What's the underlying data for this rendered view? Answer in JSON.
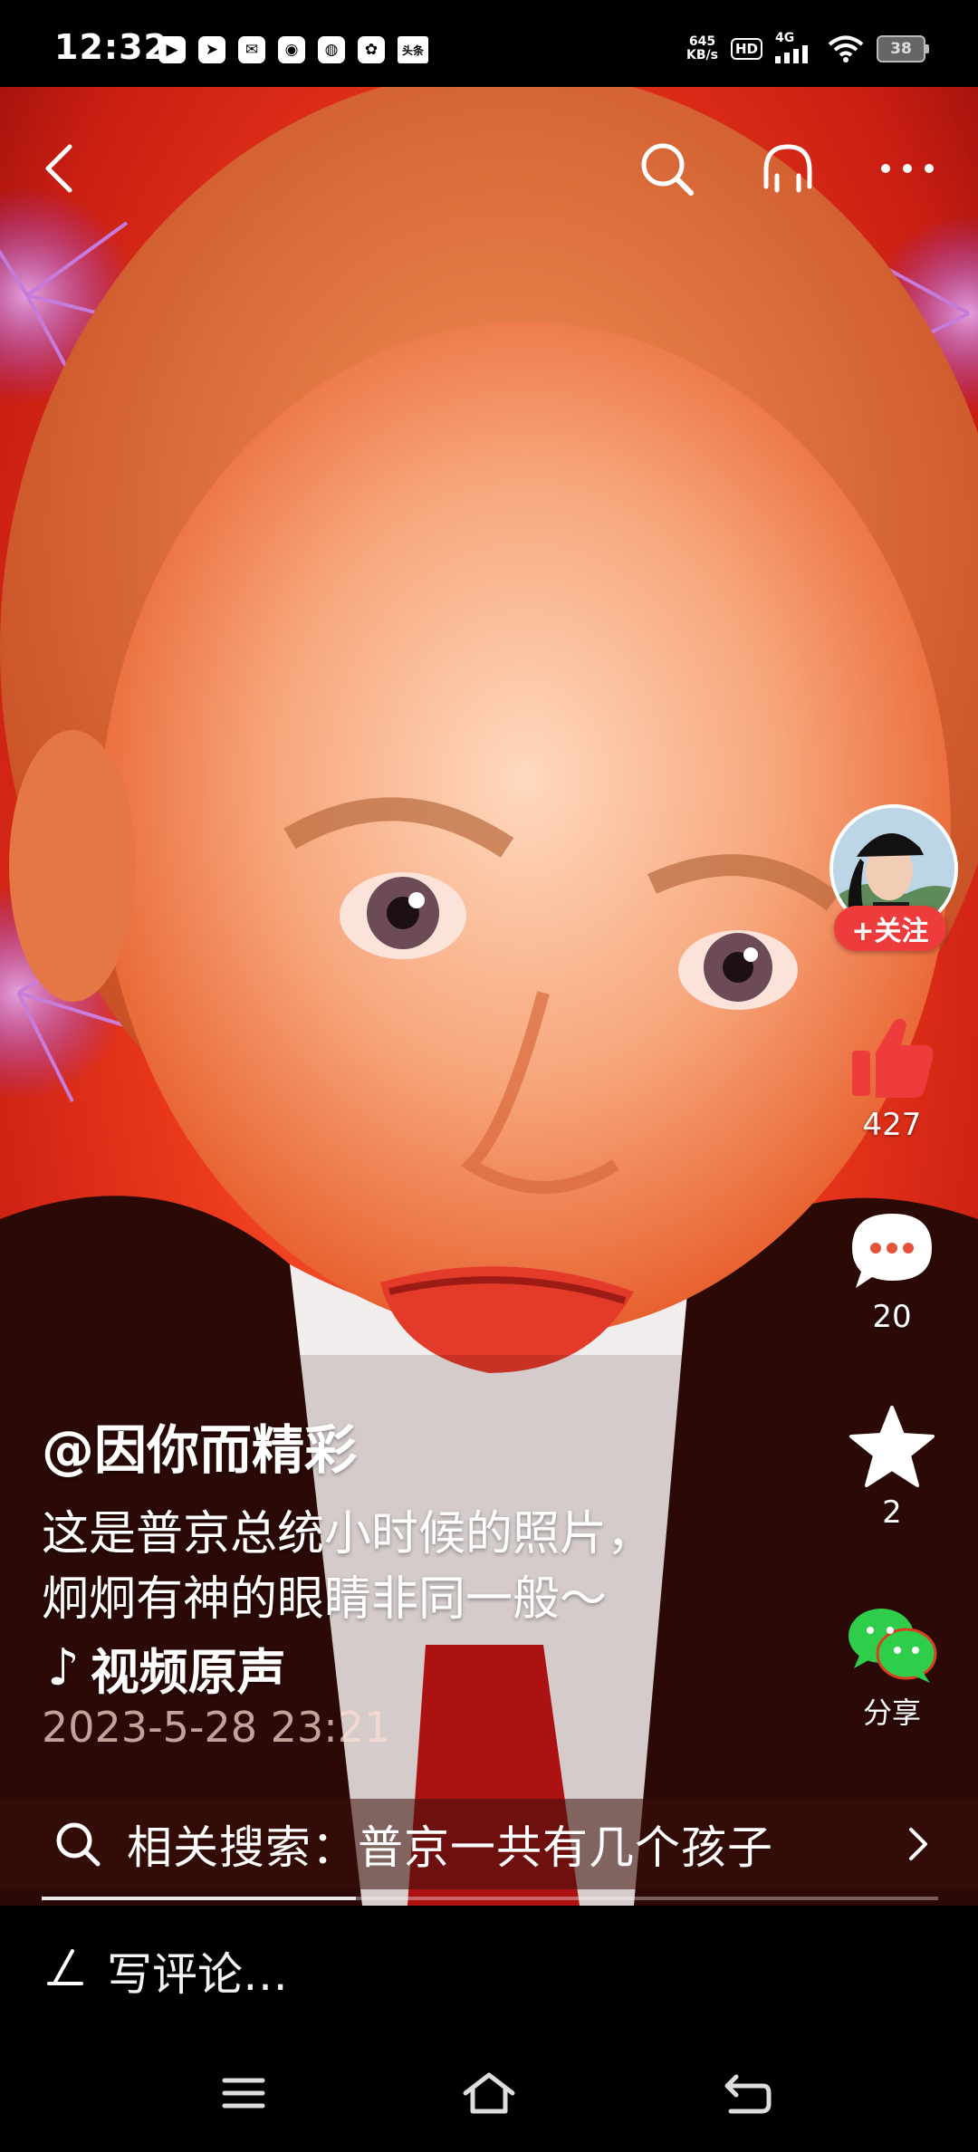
{
  "status_bar": {
    "time": "12:32",
    "app_icons": [
      "▶",
      "➤",
      "✉",
      "◉",
      "◍",
      "✿",
      "头条"
    ],
    "net_speed_value": "645",
    "net_speed_unit": "KB/s",
    "hd_label": "HD",
    "signal_label": "4G",
    "battery_level": "38"
  },
  "top_bar": {
    "back_icon": "chevron-left-icon",
    "search_icon": "search-icon",
    "listen_icon": "headphones-icon",
    "more_icon": "more-horizontal-icon"
  },
  "side_rail": {
    "follow_label": "+关注",
    "likes": "427",
    "comments": "20",
    "favorites": "2",
    "share_label": "分享",
    "colors": {
      "like": "#ee3b3b",
      "follow": "#ee3b3b",
      "share": "#2fce4a"
    }
  },
  "post": {
    "username": "@因你而精彩",
    "caption_line1": "这是普京总统小时候的照片，",
    "caption_line2": "炯炯有神的眼睛非同一般～",
    "music": "视频原声",
    "date": "2023-5-28 23:21"
  },
  "related_search": {
    "text": "相关搜索：普京一共有几个孩子"
  },
  "progress": {
    "played_fraction": 0.35
  },
  "comment_bar": {
    "placeholder": "写评论…"
  },
  "nav_bar": {
    "menu_icon": "menu-icon",
    "home_icon": "home-icon",
    "back_icon": "back-icon"
  }
}
